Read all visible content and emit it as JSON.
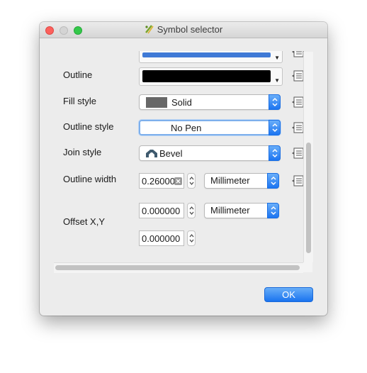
{
  "window": {
    "title": "Symbol selector"
  },
  "rows": {
    "outline": {
      "label": "Outline",
      "color": "#000000"
    },
    "fill_style": {
      "label": "Fill style",
      "value": "Solid",
      "swatch_color": "#676767"
    },
    "outline_style": {
      "label": "Outline style",
      "value": "No Pen"
    },
    "join_style": {
      "label": "Join style",
      "value": "Bevel"
    },
    "outline_width": {
      "label": "Outline width",
      "value": "0.26000",
      "unit": "Millimeter"
    },
    "offset": {
      "label": "Offset X,Y",
      "x": "0.000000",
      "y": "0.000000",
      "unit": "Millimeter"
    }
  },
  "top_partial_color": "#3f7ad6",
  "buttons": {
    "ok": "OK"
  },
  "colors": {
    "accent": "#1a73ef",
    "window_bg": "#ececec"
  },
  "icons": [
    "data-defined-override-icon",
    "bevel-join-icon",
    "clear-icon",
    "chevron-updown-icon"
  ]
}
